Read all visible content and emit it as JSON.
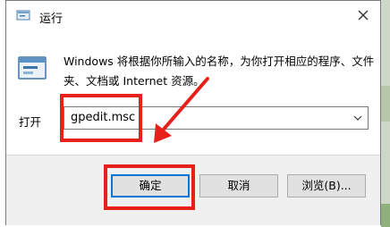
{
  "window": {
    "title": "运行",
    "description": "Windows 将根据你所输入的名称，为你打开相应的程序、文件夹、文档或 Internet 资源。"
  },
  "open": {
    "label": "打开",
    "value": "gpedit.msc"
  },
  "buttons": {
    "ok": "确定",
    "cancel": "取消",
    "browse": "浏览(B)..."
  },
  "icons": {
    "title": "run-icon",
    "main": "run-icon",
    "close": "close-icon",
    "dropdown": "chevron-down-icon"
  },
  "colors": {
    "annotation": "#e8201c",
    "focus": "#0078d7"
  }
}
